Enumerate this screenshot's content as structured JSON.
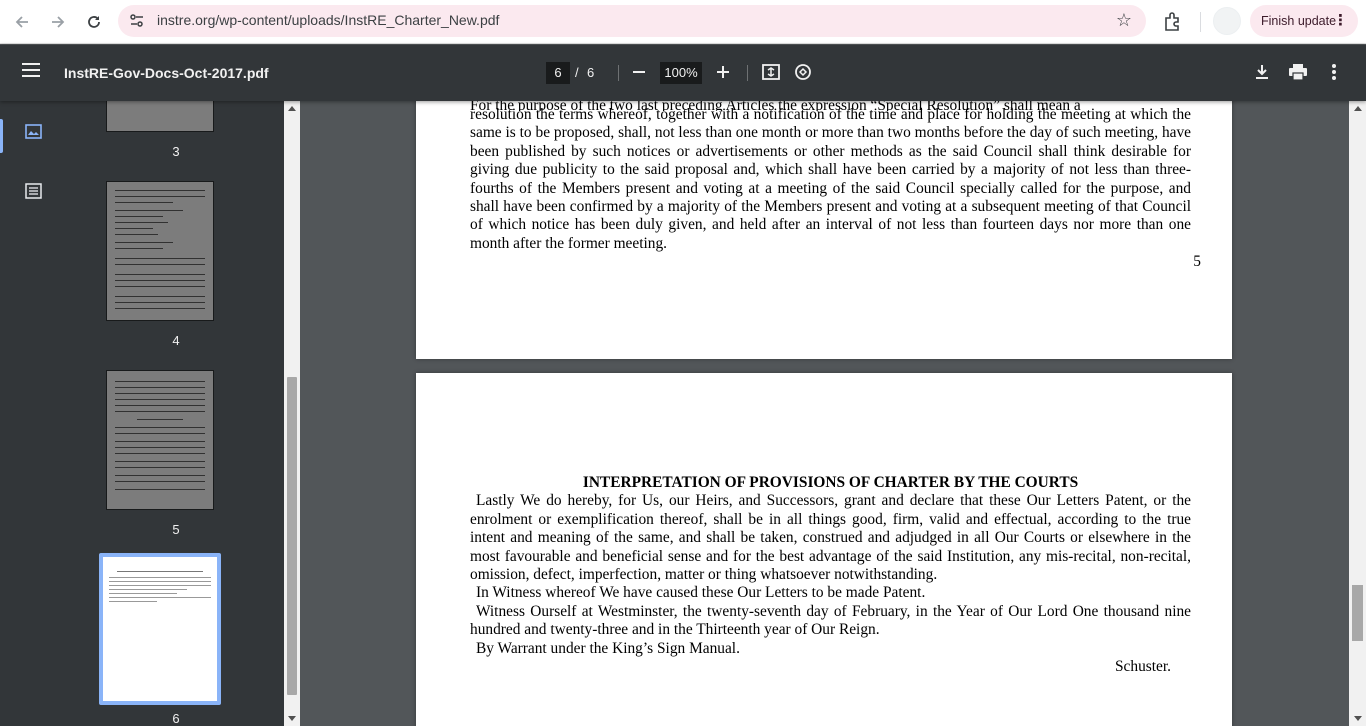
{
  "browser": {
    "url": "instre.org/wp-content/uploads/InstRE_Charter_New.pdf",
    "finish_update_label": "Finish update"
  },
  "toolbar": {
    "title": "InstRE-Gov-Docs-Oct-2017.pdf",
    "current_page": "6",
    "page_separator": "/",
    "total_pages": "6",
    "zoom": "100%"
  },
  "thumbnails": [
    {
      "number": "3"
    },
    {
      "number": "4"
    },
    {
      "number": "5"
    },
    {
      "number": "6"
    }
  ],
  "page5": {
    "cut_line": "For the purpose of the two last preceding Articles the expression “Special Resolution” shall mean a",
    "paragraph": "resolution the terms whereof, together with a notification of the time and place for holding the meeting at which the same is to be proposed, shall, not less than one month or more than two months before the day of such meeting, have been published by such notices or advertisements or other methods as the said Council shall think desirable for giving due publicity to the said proposal and, which shall have been carried by a majority of not less than three-fourths of the Members present and voting at a meeting of the said Council specially called for the purpose, and shall have been confirmed by a majority of the Members present and voting at a subsequent meeting of that Council of which notice has been duly given, and held after an interval of not less than fourteen days nor more than one month after the former meeting.",
    "page_number": "5"
  },
  "page6": {
    "heading": "INTERPRETATION OF PROVISIONS OF CHARTER BY THE COURTS",
    "para1": "Lastly We do hereby, for Us, our Heirs, and Successors, grant and declare that these Our Letters Patent, or the enrolment or exemplification thereof, shall be in all things good, firm, valid and effectual, according to the true intent and meaning of the same, and shall be taken, construed and adjudged in all Our Courts or elsewhere in the most favourable and beneficial sense and for the best advantage of the said Institution, any mis-recital, non-recital, omission, defect, imperfection, matter or thing whatsoever notwithstanding.",
    "para2": "In Witness whereof We have caused these Our Letters to be made Patent.",
    "para3": "Witness Ourself at Westminster, the twenty-seventh day of February, in the Year of Our Lord One thousand nine hundred and twenty-three and in the Thirteenth year of Our Reign.",
    "para4": "By Warrant under the King’s Sign Manual.",
    "signature": "Schuster."
  }
}
